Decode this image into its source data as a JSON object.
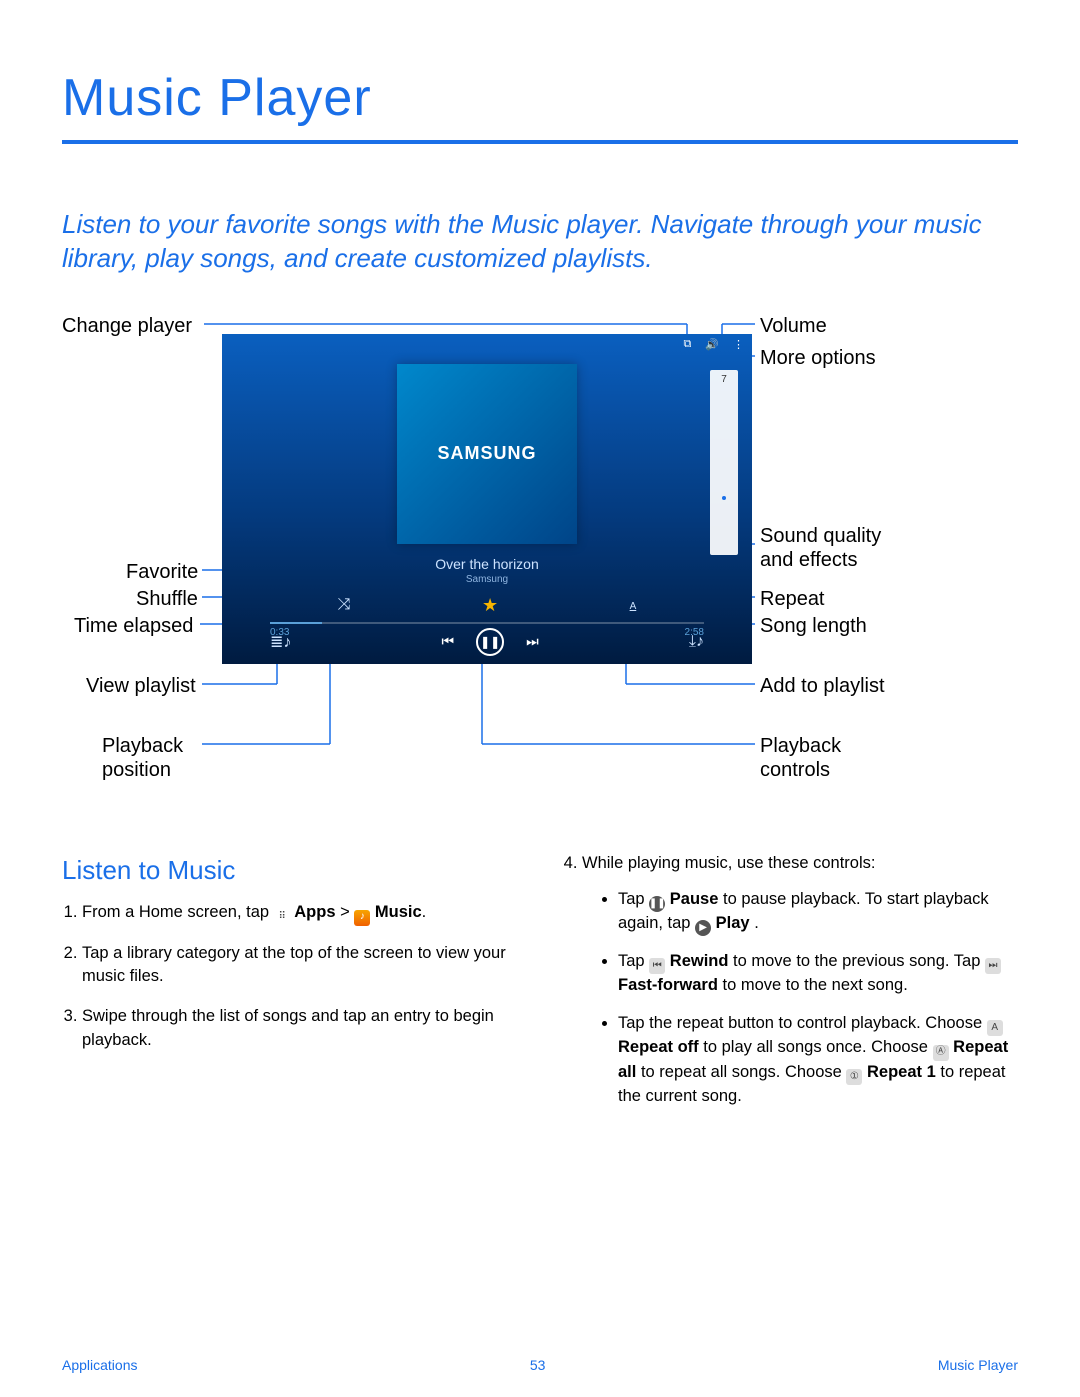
{
  "page": {
    "title": "Music Player",
    "intro": "Listen to your favorite songs with the Music player. Navigate through your music library, play songs, and create customized playlists."
  },
  "labels": {
    "change_player": "Change player",
    "favorite": "Favorite",
    "shuffle": "Shuffle",
    "time_elapsed": "Time elapsed",
    "view_playlist": "View playlist",
    "playback_position": "Playback position",
    "volume": "Volume",
    "more_options": "More options",
    "sound_quality": "Sound quality and effects",
    "repeat": "Repeat",
    "song_length": "Song length",
    "add_to_playlist": "Add to playlist",
    "playback_controls": "Playback controls"
  },
  "player": {
    "album_brand": "SAMSUNG",
    "song_title": "Over the horizon",
    "song_artist": "Samsung",
    "volume_value": "7",
    "elapsed": "0:33",
    "length": "2:58",
    "repeat_mode": "A"
  },
  "section": {
    "heading": "Listen to Music",
    "step1_pre": "From a Home screen, tap ",
    "step1_apps": "Apps",
    "step1_mid": " > ",
    "step1_music": "Music",
    "step1_post": ".",
    "step2": "Tap a library category at the top of the screen to view your music files.",
    "step3": "Swipe through the list of songs and tap an entry to begin playback.",
    "step4_intro": "While playing music, use these controls:",
    "b1_pre": "Tap ",
    "b1_pause": "Pause",
    "b1_mid": " to pause playback. To start playback again, tap ",
    "b1_play": "Play",
    "b1_post": " .",
    "b2_pre": "Tap ",
    "b2_rw": "Rewind",
    "b2_mid": " to move to the previous song. Tap ",
    "b2_ff": "Fast-forward",
    "b2_post": " to move to the next song.",
    "b3_pre": "Tap the repeat button to control playback. Choose ",
    "b3_roff": "Repeat off",
    "b3_m1": " to play all songs once. Choose ",
    "b3_rall": "Repeat all",
    "b3_m2": " to repeat all songs. Choose ",
    "b3_r1": "Repeat 1",
    "b3_m3": " to repeat the current song."
  },
  "footer": {
    "left": "Applications",
    "center": "53",
    "right": "Music Player"
  }
}
